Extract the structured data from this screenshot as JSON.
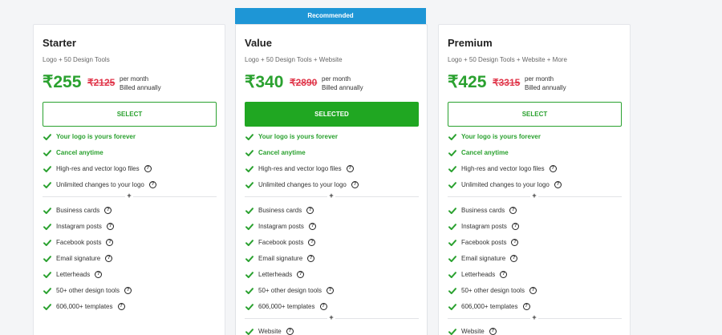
{
  "plans": [
    {
      "name": "Starter",
      "subtitle": "Logo + 50 Design Tools",
      "price": "₹255",
      "old_price": "₹2125",
      "per_month": "per month",
      "billed": "Billed annually",
      "button": "SELECT",
      "core_features": [
        {
          "label": "Your logo is yours forever",
          "highlight": true,
          "help": false
        },
        {
          "label": "Cancel anytime",
          "highlight": true,
          "help": false
        },
        {
          "label": "High-res and vector logo files",
          "highlight": false,
          "help": true
        },
        {
          "label": "Unlimited changes to your logo",
          "highlight": false,
          "help": true
        }
      ],
      "tools": [
        {
          "label": "Business cards"
        },
        {
          "label": "Instagram posts"
        },
        {
          "label": "Facebook posts"
        },
        {
          "label": "Email signature"
        },
        {
          "label": "Letterheads"
        },
        {
          "label": "50+ other design tools"
        },
        {
          "label": "606,000+ templates"
        }
      ],
      "extras": []
    },
    {
      "name": "Value",
      "subtitle": "Logo + 50 Design Tools + Website",
      "price": "₹340",
      "old_price": "₹2890",
      "per_month": "per month",
      "billed": "Billed annually",
      "button": "SELECTED",
      "ribbon": "Recommended",
      "core_features": [
        {
          "label": "Your logo is yours forever",
          "highlight": true,
          "help": false
        },
        {
          "label": "Cancel anytime",
          "highlight": true,
          "help": false
        },
        {
          "label": "High-res and vector logo files",
          "highlight": false,
          "help": true
        },
        {
          "label": "Unlimited changes to your logo",
          "highlight": false,
          "help": true
        }
      ],
      "tools": [
        {
          "label": "Business cards"
        },
        {
          "label": "Instagram posts"
        },
        {
          "label": "Facebook posts"
        },
        {
          "label": "Email signature"
        },
        {
          "label": "Letterheads"
        },
        {
          "label": "50+ other design tools"
        },
        {
          "label": "606,000+ templates"
        }
      ],
      "extras": [
        {
          "label": "Website"
        }
      ]
    },
    {
      "name": "Premium",
      "subtitle": "Logo + 50 Design Tools + Website + More",
      "price": "₹425",
      "old_price": "₹3315",
      "per_month": "per month",
      "billed": "Billed annually",
      "button": "SELECT",
      "core_features": [
        {
          "label": "Your logo is yours forever",
          "highlight": true,
          "help": false
        },
        {
          "label": "Cancel anytime",
          "highlight": true,
          "help": false
        },
        {
          "label": "High-res and vector logo files",
          "highlight": false,
          "help": true
        },
        {
          "label": "Unlimited changes to your logo",
          "highlight": false,
          "help": true
        }
      ],
      "tools": [
        {
          "label": "Business cards"
        },
        {
          "label": "Instagram posts"
        },
        {
          "label": "Facebook posts"
        },
        {
          "label": "Email signature"
        },
        {
          "label": "Letterheads"
        },
        {
          "label": "50+ other design tools"
        },
        {
          "label": "606,000+ templates"
        }
      ],
      "extras": [
        {
          "label": "Website"
        }
      ]
    }
  ],
  "plus_sign": "+",
  "help_glyph": "?",
  "colors": {
    "accent_green": "#2aa12f",
    "selected_green": "#20a722",
    "strike_red": "#e0364a",
    "ribbon_blue": "#1e96d6"
  }
}
